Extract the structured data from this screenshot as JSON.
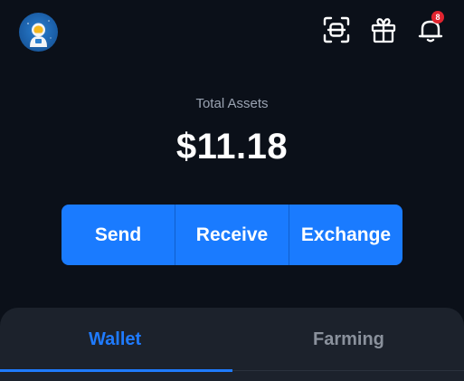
{
  "header": {
    "avatar_icon": "astronaut-avatar",
    "icons": [
      "scan-icon",
      "gift-icon",
      "bell-icon"
    ],
    "notification_count": "8"
  },
  "summary": {
    "label": "Total Assets",
    "value": "$11.18"
  },
  "actions": {
    "send_label": "Send",
    "receive_label": "Receive",
    "exchange_label": "Exchange"
  },
  "tabs": {
    "wallet_label": "Wallet",
    "farming_label": "Farming",
    "active": "Wallet"
  },
  "colors": {
    "background": "#0b1019",
    "accent": "#1a7bff",
    "panel": "#1c222c",
    "badge": "#e0242f",
    "muted_text": "#9aa3b2"
  }
}
